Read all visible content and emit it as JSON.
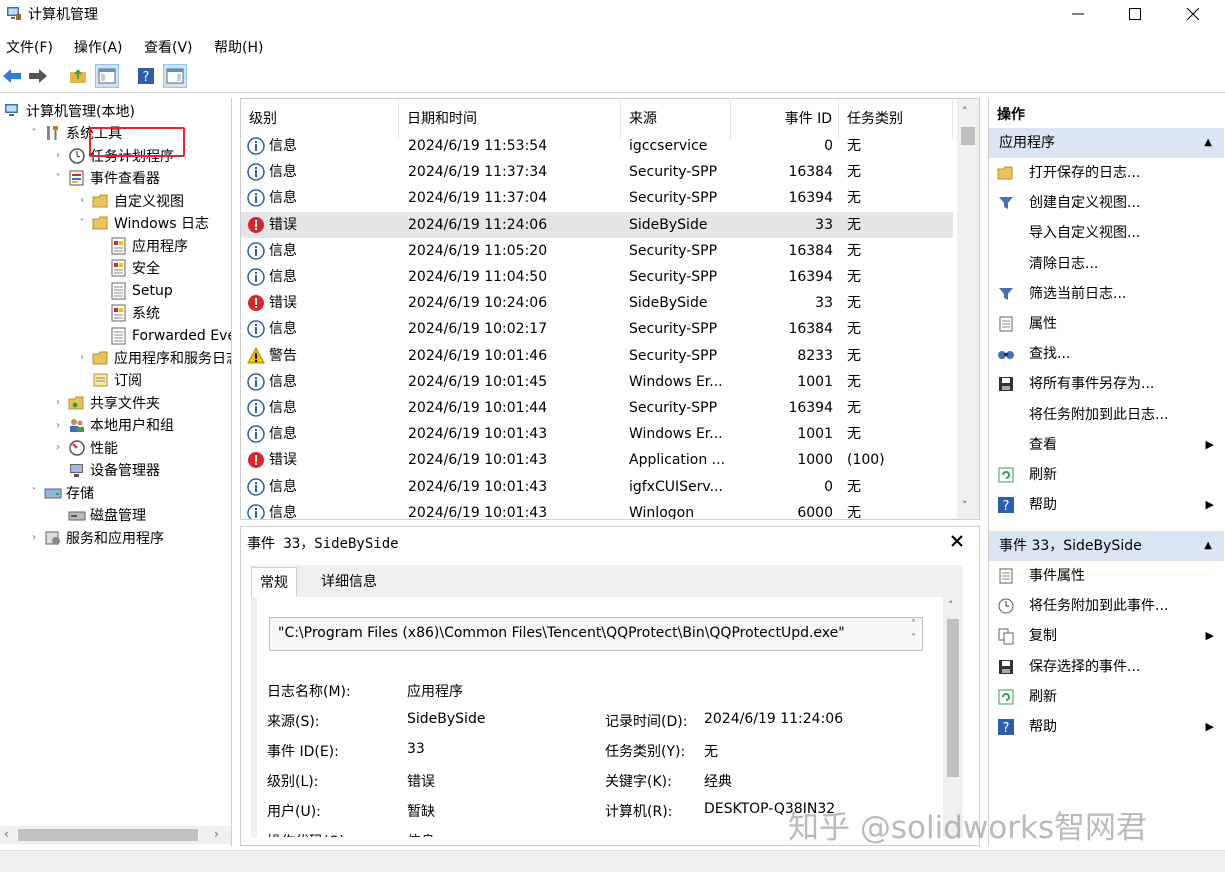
{
  "window": {
    "title": "计算机管理",
    "minimize_icon": "minimize-icon",
    "maximize_icon": "maximize-icon",
    "close_icon": "close-icon"
  },
  "menu": [
    "文件(F)",
    "操作(A)",
    "查看(V)",
    "帮助(H)"
  ],
  "tree": [
    {
      "label": "计算机管理(本地)",
      "level": 0,
      "icon": "computer-icon",
      "toggle": ""
    },
    {
      "label": "系统工具",
      "level": 1,
      "icon": "tools-icon",
      "toggle": "v"
    },
    {
      "label": "任务计划程序",
      "level": 2,
      "icon": "clock-icon",
      "toggle": ">"
    },
    {
      "label": "事件查看器",
      "level": 2,
      "icon": "event-viewer-icon",
      "toggle": "v"
    },
    {
      "label": "自定义视图",
      "level": 3,
      "icon": "folder-icon",
      "toggle": ">"
    },
    {
      "label": "Windows 日志",
      "level": 3,
      "icon": "folder-icon",
      "toggle": "v"
    },
    {
      "label": "应用程序",
      "level": 4,
      "icon": "log-icon",
      "toggle": ""
    },
    {
      "label": "安全",
      "level": 4,
      "icon": "log-icon",
      "toggle": ""
    },
    {
      "label": "Setup",
      "level": 4,
      "icon": "log-plain-icon",
      "toggle": ""
    },
    {
      "label": "系统",
      "level": 4,
      "icon": "log-icon",
      "toggle": ""
    },
    {
      "label": "Forwarded Even",
      "level": 4,
      "icon": "log-plain-icon",
      "toggle": ""
    },
    {
      "label": "应用程序和服务日志",
      "level": 3,
      "icon": "folder-icon",
      "toggle": ">"
    },
    {
      "label": "订阅",
      "level": 3,
      "icon": "subscription-icon",
      "toggle": ""
    },
    {
      "label": "共享文件夹",
      "level": 2,
      "icon": "shared-folder-icon",
      "toggle": ">"
    },
    {
      "label": "本地用户和组",
      "level": 2,
      "icon": "users-icon",
      "toggle": ">"
    },
    {
      "label": "性能",
      "level": 2,
      "icon": "performance-icon",
      "toggle": ">"
    },
    {
      "label": "设备管理器",
      "level": 2,
      "icon": "device-manager-icon",
      "toggle": ""
    },
    {
      "label": "存储",
      "level": 1,
      "icon": "storage-icon",
      "toggle": "v"
    },
    {
      "label": "磁盘管理",
      "level": 2,
      "icon": "disk-icon",
      "toggle": ""
    },
    {
      "label": "服务和应用程序",
      "level": 1,
      "icon": "services-icon",
      "toggle": ">"
    }
  ],
  "events": {
    "columns": [
      "级别",
      "日期和时间",
      "来源",
      "事件 ID",
      "任务类别"
    ],
    "rows": [
      {
        "level": "信息",
        "type": "info",
        "datetime": "2024/6/19 11:53:54",
        "source": "igccservice",
        "id": "0",
        "task": "无"
      },
      {
        "level": "信息",
        "type": "info",
        "datetime": "2024/6/19 11:37:34",
        "source": "Security-SPP",
        "id": "16384",
        "task": "无"
      },
      {
        "level": "信息",
        "type": "info",
        "datetime": "2024/6/19 11:37:04",
        "source": "Security-SPP",
        "id": "16394",
        "task": "无"
      },
      {
        "level": "错误",
        "type": "error",
        "datetime": "2024/6/19 11:24:06",
        "source": "SideBySide",
        "id": "33",
        "task": "无"
      },
      {
        "level": "信息",
        "type": "info",
        "datetime": "2024/6/19 11:05:20",
        "source": "Security-SPP",
        "id": "16384",
        "task": "无"
      },
      {
        "level": "信息",
        "type": "info",
        "datetime": "2024/6/19 11:04:50",
        "source": "Security-SPP",
        "id": "16394",
        "task": "无"
      },
      {
        "level": "错误",
        "type": "error",
        "datetime": "2024/6/19 10:24:06",
        "source": "SideBySide",
        "id": "33",
        "task": "无"
      },
      {
        "level": "信息",
        "type": "info",
        "datetime": "2024/6/19 10:02:17",
        "source": "Security-SPP",
        "id": "16384",
        "task": "无"
      },
      {
        "level": "警告",
        "type": "warning",
        "datetime": "2024/6/19 10:01:46",
        "source": "Security-SPP",
        "id": "8233",
        "task": "无"
      },
      {
        "level": "信息",
        "type": "info",
        "datetime": "2024/6/19 10:01:45",
        "source": "Windows Er...",
        "id": "1001",
        "task": "无"
      },
      {
        "level": "信息",
        "type": "info",
        "datetime": "2024/6/19 10:01:44",
        "source": "Security-SPP",
        "id": "16394",
        "task": "无"
      },
      {
        "level": "信息",
        "type": "info",
        "datetime": "2024/6/19 10:01:43",
        "source": "Windows Er...",
        "id": "1001",
        "task": "无"
      },
      {
        "level": "错误",
        "type": "error",
        "datetime": "2024/6/19 10:01:43",
        "source": "Application ...",
        "id": "1000",
        "task": "(100)"
      },
      {
        "level": "信息",
        "type": "info",
        "datetime": "2024/6/19 10:01:43",
        "source": "igfxCUIServ...",
        "id": "0",
        "task": "无"
      },
      {
        "level": "信息",
        "type": "info",
        "datetime": "2024/6/19 10:01:43",
        "source": "Winlogon",
        "id": "6000",
        "task": "无"
      }
    ]
  },
  "details": {
    "title": "事件 33，SideBySide",
    "tabs": [
      "常规",
      "详细信息"
    ],
    "message": "\"C:\\Program Files (x86)\\Common Files\\Tencent\\QQProtect\\Bin\\QQProtectUpd.exe\"",
    "fields_left": [
      {
        "label": "日志名称(M):",
        "value": "应用程序"
      },
      {
        "label": "来源(S):",
        "value": "SideBySide"
      },
      {
        "label": "事件 ID(E):",
        "value": "33"
      },
      {
        "label": "级别(L):",
        "value": "错误"
      },
      {
        "label": "用户(U):",
        "value": "暂缺"
      },
      {
        "label": "操作代码(O):",
        "value": "信息"
      }
    ],
    "fields_right": [
      {
        "label": "记录时间(D):",
        "value": "2024/6/19 11:24:06"
      },
      {
        "label": "任务类别(Y):",
        "value": "无"
      },
      {
        "label": "关键字(K):",
        "value": "经典"
      },
      {
        "label": "计算机(R):",
        "value": "DESKTOP-Q38IN32"
      }
    ]
  },
  "actions": {
    "title": "操作",
    "section1": "应用程序",
    "items1": [
      {
        "label": "打开保存的日志...",
        "icon": "open-folder-icon",
        "arrow": false
      },
      {
        "label": "创建自定义视图...",
        "icon": "filter-icon",
        "arrow": false
      },
      {
        "label": "导入自定义视图...",
        "icon": "",
        "arrow": false
      },
      {
        "label": "清除日志...",
        "icon": "",
        "arrow": false
      },
      {
        "label": "筛选当前日志...",
        "icon": "filter-icon",
        "arrow": false
      },
      {
        "label": "属性",
        "icon": "properties-icon",
        "arrow": false
      },
      {
        "label": "查找...",
        "icon": "find-icon",
        "arrow": false
      },
      {
        "label": "将所有事件另存为...",
        "icon": "save-icon",
        "arrow": false
      },
      {
        "label": "将任务附加到此日志...",
        "icon": "",
        "arrow": false
      },
      {
        "label": "查看",
        "icon": "",
        "arrow": true
      },
      {
        "label": "刷新",
        "icon": "refresh-icon",
        "arrow": false
      },
      {
        "label": "帮助",
        "icon": "help-icon",
        "arrow": true
      }
    ],
    "section2": "事件 33，SideBySide",
    "items2": [
      {
        "label": "事件属性",
        "icon": "properties-icon",
        "arrow": false
      },
      {
        "label": "将任务附加到此事件...",
        "icon": "task-icon",
        "arrow": false
      },
      {
        "label": "复制",
        "icon": "copy-icon",
        "arrow": true
      },
      {
        "label": "保存选择的事件...",
        "icon": "save-icon",
        "arrow": false
      },
      {
        "label": "刷新",
        "icon": "refresh-icon",
        "arrow": false
      },
      {
        "label": "帮助",
        "icon": "help-icon",
        "arrow": true
      }
    ]
  },
  "watermark": "知乎 @solidworks智网君",
  "colors": {
    "accent": "#dae6f3",
    "error": "#d9262c",
    "info": "#2f5fa8",
    "warning": "#f2c200",
    "highlight": "#e3262b"
  }
}
